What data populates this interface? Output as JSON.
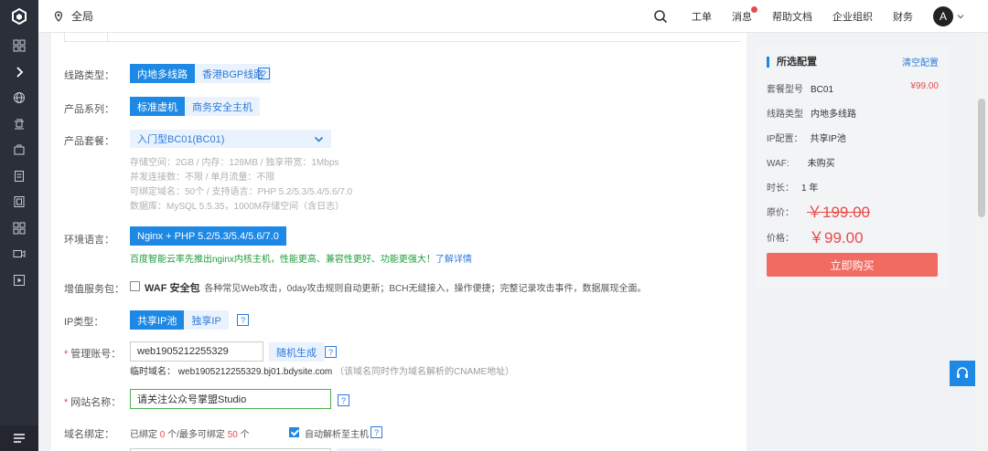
{
  "topbar": {
    "region": "全局",
    "links": [
      "工单",
      "消息",
      "帮助文档",
      "企业组织",
      "财务"
    ],
    "avatar_letter": "A"
  },
  "form": {
    "line_type": {
      "label": "线路类型：",
      "options": [
        "内地多线路",
        "香港BGP线路"
      ],
      "selected": "内地多线路"
    },
    "product_series": {
      "label": "产品系列：",
      "options": [
        "标准虚机",
        "商务安全主机"
      ],
      "selected": "标准虚机"
    },
    "package": {
      "label": "产品套餐：",
      "selected": "入门型BC01(BC01)",
      "details": [
        "存储空间：2GB / 内存：128MB / 独享带宽：1Mbps",
        "并发连接数：不限 / 单月流量：不限",
        "可绑定域名：50个 / 支持语言：PHP 5.2/5.3/5.4/5.6/7.0",
        "数据库：MySQL 5.5.35，1000M存储空间（含日志）"
      ]
    },
    "env": {
      "label": "环境语言：",
      "value": "Nginx + PHP 5.2/5.3/5.4/5.6/7.0",
      "note": "百度智能云率先推出nginx内核主机，性能更高、兼容性更好、功能更强大！",
      "note_link": "了解详情"
    },
    "addon": {
      "label": "增值服务包：",
      "waf_name": "WAF 安全包",
      "waf_desc": "各种常见Web攻击，0day攻击规则自动更新；BCH无缝接入，操作便捷；完整记录攻击事件，数据展现全面。",
      "checked": false
    },
    "ip_type": {
      "label": "IP类型：",
      "options": [
        "共享IP池",
        "独享IP"
      ],
      "selected": "共享IP池"
    },
    "admin": {
      "label": "管理账号：",
      "value": "web1905212255329",
      "generate": "随机生成",
      "temp_domain_label": "临时域名：",
      "temp_domain": "web1905212255329.bj01.bdysite.com",
      "temp_hint": "（该域名同时作为域名解析的CNAME地址）"
    },
    "site_name": {
      "label": "网站名称：",
      "value": "请关注公众号掌盟Studio"
    },
    "domain_bind": {
      "label": "域名绑定：",
      "bound_prefix": "已绑定",
      "bound_count": "0",
      "bound_mid": "个/最多可绑定",
      "max_count": "50",
      "bound_suffix": "个",
      "auto_resolve_label": "自动解析至主机",
      "auto_resolve_checked": true
    }
  },
  "panel": {
    "title": "所选配置",
    "clear": "清空配置",
    "rows": [
      {
        "label": "套餐型号",
        "value": "BC01",
        "price": "¥99.00"
      },
      {
        "label": "线路类型",
        "value": "内地多线路"
      },
      {
        "label": "IP配置：",
        "value": "共享IP池"
      },
      {
        "label": "WAF:",
        "value": "未购买"
      },
      {
        "label": "时长：",
        "value": "1 年"
      }
    ],
    "orig_label": "原价：",
    "orig_price": "￥199.00",
    "now_label": "价格：",
    "now_price": "￥99.00",
    "buy": "立即购买"
  },
  "colors": {
    "accent": "#1e88e5",
    "price": "#e94b4b",
    "buy": "#f26b63",
    "sidebar": "#2b2f3a"
  }
}
